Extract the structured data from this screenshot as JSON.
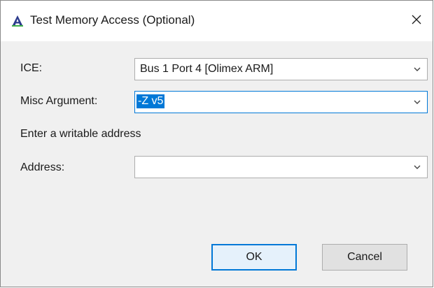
{
  "window": {
    "title": "Test Memory Access (Optional)",
    "app_icon": "letter-a-logo-icon",
    "close_icon": "close-icon"
  },
  "form": {
    "ice": {
      "label": "ICE:",
      "value": "Bus 1 Port 4 [Olimex ARM]"
    },
    "misc": {
      "label": "Misc Argument:",
      "value": "-Z v5"
    },
    "instruction": "Enter a writable address",
    "address": {
      "label": "Address:",
      "value": ""
    }
  },
  "buttons": {
    "ok": "OK",
    "cancel": "Cancel"
  },
  "colors": {
    "selection": "#0078d7",
    "default_button_border": "#0078d7",
    "dialog_background": "#f0f0f0"
  }
}
